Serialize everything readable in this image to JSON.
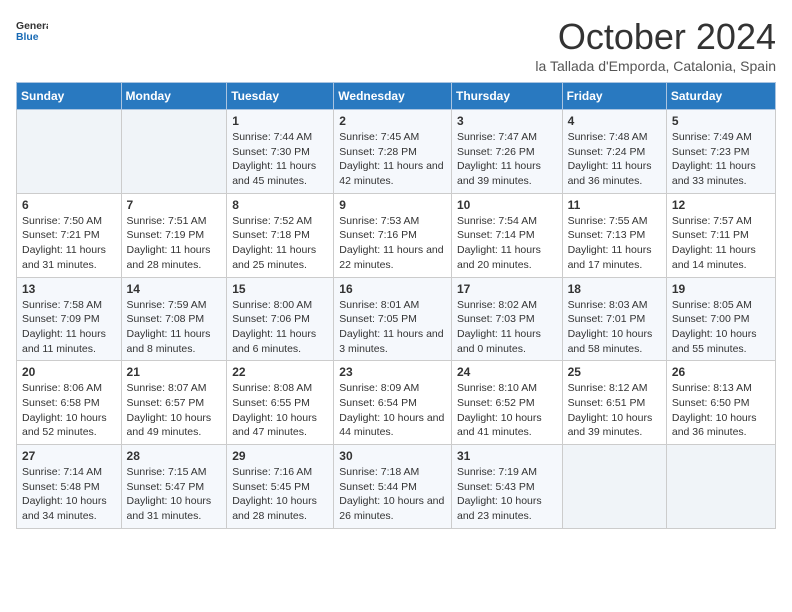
{
  "header": {
    "logo_general": "General",
    "logo_blue": "Blue",
    "month_title": "October 2024",
    "location": "la Tallada d'Emporda, Catalonia, Spain"
  },
  "weekdays": [
    "Sunday",
    "Monday",
    "Tuesday",
    "Wednesday",
    "Thursday",
    "Friday",
    "Saturday"
  ],
  "weeks": [
    [
      {
        "day": "",
        "sunrise": "",
        "sunset": "",
        "daylight": ""
      },
      {
        "day": "",
        "sunrise": "",
        "sunset": "",
        "daylight": ""
      },
      {
        "day": "1",
        "sunrise": "Sunrise: 7:44 AM",
        "sunset": "Sunset: 7:30 PM",
        "daylight": "Daylight: 11 hours and 45 minutes."
      },
      {
        "day": "2",
        "sunrise": "Sunrise: 7:45 AM",
        "sunset": "Sunset: 7:28 PM",
        "daylight": "Daylight: 11 hours and 42 minutes."
      },
      {
        "day": "3",
        "sunrise": "Sunrise: 7:47 AM",
        "sunset": "Sunset: 7:26 PM",
        "daylight": "Daylight: 11 hours and 39 minutes."
      },
      {
        "day": "4",
        "sunrise": "Sunrise: 7:48 AM",
        "sunset": "Sunset: 7:24 PM",
        "daylight": "Daylight: 11 hours and 36 minutes."
      },
      {
        "day": "5",
        "sunrise": "Sunrise: 7:49 AM",
        "sunset": "Sunset: 7:23 PM",
        "daylight": "Daylight: 11 hours and 33 minutes."
      }
    ],
    [
      {
        "day": "6",
        "sunrise": "Sunrise: 7:50 AM",
        "sunset": "Sunset: 7:21 PM",
        "daylight": "Daylight: 11 hours and 31 minutes."
      },
      {
        "day": "7",
        "sunrise": "Sunrise: 7:51 AM",
        "sunset": "Sunset: 7:19 PM",
        "daylight": "Daylight: 11 hours and 28 minutes."
      },
      {
        "day": "8",
        "sunrise": "Sunrise: 7:52 AM",
        "sunset": "Sunset: 7:18 PM",
        "daylight": "Daylight: 11 hours and 25 minutes."
      },
      {
        "day": "9",
        "sunrise": "Sunrise: 7:53 AM",
        "sunset": "Sunset: 7:16 PM",
        "daylight": "Daylight: 11 hours and 22 minutes."
      },
      {
        "day": "10",
        "sunrise": "Sunrise: 7:54 AM",
        "sunset": "Sunset: 7:14 PM",
        "daylight": "Daylight: 11 hours and 20 minutes."
      },
      {
        "day": "11",
        "sunrise": "Sunrise: 7:55 AM",
        "sunset": "Sunset: 7:13 PM",
        "daylight": "Daylight: 11 hours and 17 minutes."
      },
      {
        "day": "12",
        "sunrise": "Sunrise: 7:57 AM",
        "sunset": "Sunset: 7:11 PM",
        "daylight": "Daylight: 11 hours and 14 minutes."
      }
    ],
    [
      {
        "day": "13",
        "sunrise": "Sunrise: 7:58 AM",
        "sunset": "Sunset: 7:09 PM",
        "daylight": "Daylight: 11 hours and 11 minutes."
      },
      {
        "day": "14",
        "sunrise": "Sunrise: 7:59 AM",
        "sunset": "Sunset: 7:08 PM",
        "daylight": "Daylight: 11 hours and 8 minutes."
      },
      {
        "day": "15",
        "sunrise": "Sunrise: 8:00 AM",
        "sunset": "Sunset: 7:06 PM",
        "daylight": "Daylight: 11 hours and 6 minutes."
      },
      {
        "day": "16",
        "sunrise": "Sunrise: 8:01 AM",
        "sunset": "Sunset: 7:05 PM",
        "daylight": "Daylight: 11 hours and 3 minutes."
      },
      {
        "day": "17",
        "sunrise": "Sunrise: 8:02 AM",
        "sunset": "Sunset: 7:03 PM",
        "daylight": "Daylight: 11 hours and 0 minutes."
      },
      {
        "day": "18",
        "sunrise": "Sunrise: 8:03 AM",
        "sunset": "Sunset: 7:01 PM",
        "daylight": "Daylight: 10 hours and 58 minutes."
      },
      {
        "day": "19",
        "sunrise": "Sunrise: 8:05 AM",
        "sunset": "Sunset: 7:00 PM",
        "daylight": "Daylight: 10 hours and 55 minutes."
      }
    ],
    [
      {
        "day": "20",
        "sunrise": "Sunrise: 8:06 AM",
        "sunset": "Sunset: 6:58 PM",
        "daylight": "Daylight: 10 hours and 52 minutes."
      },
      {
        "day": "21",
        "sunrise": "Sunrise: 8:07 AM",
        "sunset": "Sunset: 6:57 PM",
        "daylight": "Daylight: 10 hours and 49 minutes."
      },
      {
        "day": "22",
        "sunrise": "Sunrise: 8:08 AM",
        "sunset": "Sunset: 6:55 PM",
        "daylight": "Daylight: 10 hours and 47 minutes."
      },
      {
        "day": "23",
        "sunrise": "Sunrise: 8:09 AM",
        "sunset": "Sunset: 6:54 PM",
        "daylight": "Daylight: 10 hours and 44 minutes."
      },
      {
        "day": "24",
        "sunrise": "Sunrise: 8:10 AM",
        "sunset": "Sunset: 6:52 PM",
        "daylight": "Daylight: 10 hours and 41 minutes."
      },
      {
        "day": "25",
        "sunrise": "Sunrise: 8:12 AM",
        "sunset": "Sunset: 6:51 PM",
        "daylight": "Daylight: 10 hours and 39 minutes."
      },
      {
        "day": "26",
        "sunrise": "Sunrise: 8:13 AM",
        "sunset": "Sunset: 6:50 PM",
        "daylight": "Daylight: 10 hours and 36 minutes."
      }
    ],
    [
      {
        "day": "27",
        "sunrise": "Sunrise: 7:14 AM",
        "sunset": "Sunset: 5:48 PM",
        "daylight": "Daylight: 10 hours and 34 minutes."
      },
      {
        "day": "28",
        "sunrise": "Sunrise: 7:15 AM",
        "sunset": "Sunset: 5:47 PM",
        "daylight": "Daylight: 10 hours and 31 minutes."
      },
      {
        "day": "29",
        "sunrise": "Sunrise: 7:16 AM",
        "sunset": "Sunset: 5:45 PM",
        "daylight": "Daylight: 10 hours and 28 minutes."
      },
      {
        "day": "30",
        "sunrise": "Sunrise: 7:18 AM",
        "sunset": "Sunset: 5:44 PM",
        "daylight": "Daylight: 10 hours and 26 minutes."
      },
      {
        "day": "31",
        "sunrise": "Sunrise: 7:19 AM",
        "sunset": "Sunset: 5:43 PM",
        "daylight": "Daylight: 10 hours and 23 minutes."
      },
      {
        "day": "",
        "sunrise": "",
        "sunset": "",
        "daylight": ""
      },
      {
        "day": "",
        "sunrise": "",
        "sunset": "",
        "daylight": ""
      }
    ]
  ]
}
